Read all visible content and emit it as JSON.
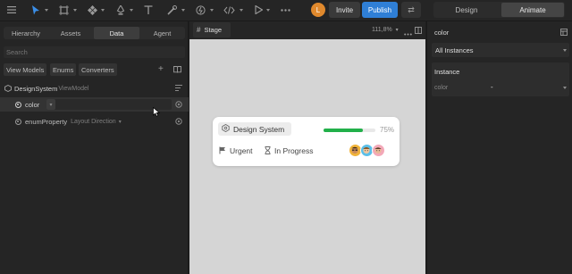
{
  "toolbar": {
    "icons": [
      "menu-icon",
      "pointer-icon",
      "frame-icon",
      "components-icon",
      "pen-icon",
      "text-icon",
      "shape-tools-icon",
      "constraints-icon",
      "code-icon",
      "play-icon",
      "more-icon"
    ],
    "avatar_initial": "L",
    "invite_label": "Invite",
    "publish_label": "Publish",
    "swap_icon": "swap-icon",
    "mode_design": "Design",
    "mode_animate": "Animate",
    "accent": "#2f7fd6"
  },
  "left_panel": {
    "tabs": [
      "Hierarchy",
      "Assets",
      "Data",
      "Agent"
    ],
    "active_tab": "Data",
    "search_placeholder": "Search",
    "chips": [
      "View Models",
      "Enums",
      "Converters"
    ],
    "add_icon": "plus-icon",
    "book_icon": "book-icon",
    "viewmodel": {
      "name": "DesignSystem",
      "type": "ViewModel"
    },
    "properties": [
      {
        "name": "color",
        "type": ""
      },
      {
        "name": "enumProperty",
        "type": "Layout Direction"
      }
    ]
  },
  "stage": {
    "tab_label": "Stage",
    "zoom": "111,8%",
    "card": {
      "title": "Design System",
      "progress_percent": 75,
      "progress_label": "75%",
      "progress_color": "#22b04a",
      "tags": [
        "Urgent",
        "In Progress"
      ]
    }
  },
  "right_panel": {
    "title": "color",
    "instances_select": "All Instances",
    "section_title": "Instance",
    "field_label": "color",
    "field_value": "-"
  }
}
